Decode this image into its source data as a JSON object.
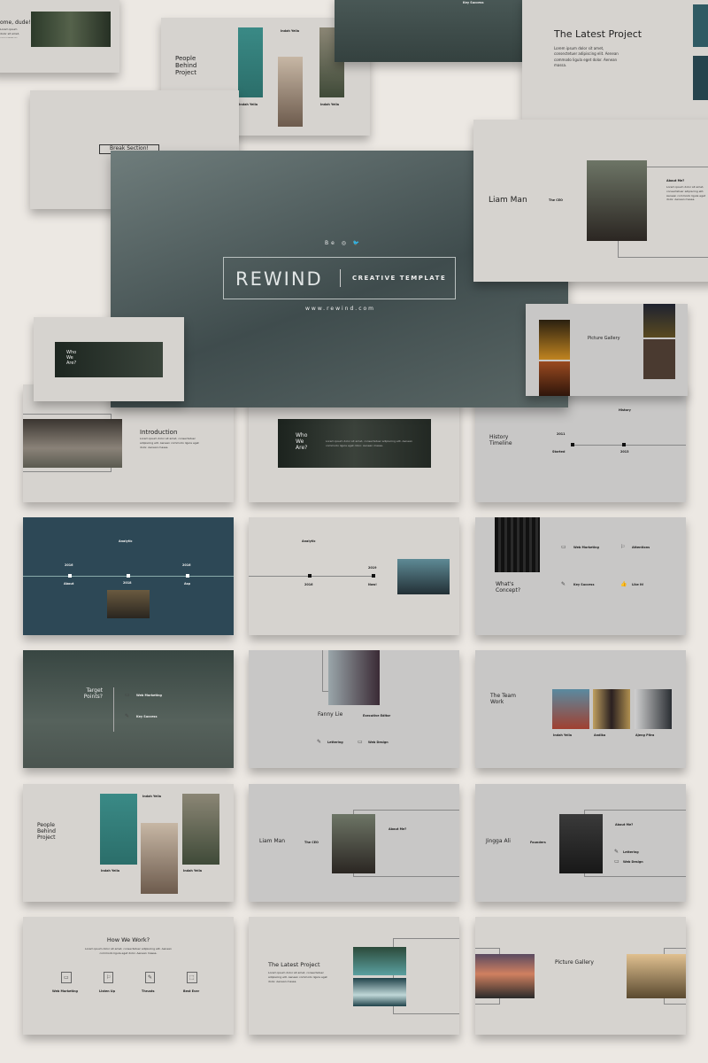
{
  "lorem": "Lorem ipsum dolor sit amet, consectetuer adipiscing elit. Aenean commodo ligula eget dolor. Aenean massa.",
  "hero": {
    "title": "REWIND",
    "subtitle": "CREATIVE TEMPLATE",
    "url": "www.rewind.com",
    "social": [
      "Be",
      "◎",
      "🐦"
    ]
  },
  "top": {
    "welcome": "ome, dude!",
    "people_title": "People Behind Project",
    "names": [
      "Indah Yella",
      "Indah Yella",
      "Indah Yella"
    ],
    "key_success": "Key Success",
    "latest_title": "The Latest Project",
    "break_label": "Break Section!",
    "liam_name": "Liam Man",
    "liam_role": "The CEO",
    "about": "About Me?",
    "who": "Who We Are?",
    "gallery": "Picture Gallery"
  },
  "grid": {
    "intro": "Introduction",
    "who": "Who We Are?",
    "history": {
      "title": "History Timeline",
      "top_label": "History",
      "year1": "2011",
      "year2": "2013",
      "bottom_label": "Started"
    },
    "analytic_dark": {
      "top_label": "Analytic",
      "years": [
        "2016",
        "2018",
        "2016"
      ],
      "labels": [
        "About",
        "Asp"
      ]
    },
    "analytic_light": {
      "top_label": "Analytic",
      "years": [
        "2016",
        "2019"
      ],
      "bottom_label": "Now!"
    },
    "concept": {
      "title": "What's Concept?",
      "items": [
        "Web Marketing",
        "Attentions",
        "Key Success",
        "Like It!"
      ]
    },
    "target": {
      "title": "Target Points?",
      "items": [
        "Web Marketing",
        "Key Success"
      ]
    },
    "fanny": {
      "name": "Fanny Lie",
      "role": "Executive Editor",
      "skills": [
        "Lettering",
        "Web Design"
      ]
    },
    "team": {
      "title": "The Team Work",
      "names": [
        "Indah Yella",
        "Andika",
        "Ajeng Pitra"
      ]
    },
    "people": {
      "title": "People Behind Project",
      "names": [
        "Indah Yella",
        "Indah Yella",
        "Indah Yella"
      ]
    },
    "liam": {
      "name": "Liam Man",
      "role": "The CEO",
      "about": "About Me?"
    },
    "jingga": {
      "name": "Jingga Ali",
      "role": "Founders",
      "about": "About Me?",
      "skills": [
        "Lettering",
        "Web Design"
      ]
    },
    "how": {
      "title": "How We Work?",
      "items": [
        "Web Marketing",
        "Listen Up",
        "Thrusts",
        "Best Ever"
      ]
    },
    "latest": "The Latest Project",
    "gallery": "Picture Gallery"
  },
  "colors": {
    "paper": "#ece8e3",
    "slide": "#d6d3cf",
    "dark_teal": "#2d4856"
  }
}
